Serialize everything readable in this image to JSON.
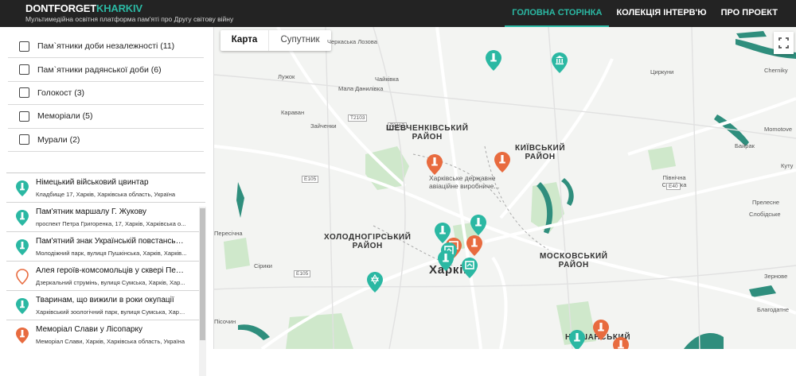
{
  "header": {
    "brand_part1": "DONTFORGET",
    "brand_part2": "KHARKIV",
    "tagline": "Мультимедійна освітня платформа пам'яті про Другу світову війну",
    "nav": [
      "ГОЛОВНА СТОРІНКА",
      "КОЛЕКЦІЯ ІНТЕРВ'Ю",
      "ПРО ПРОЕКТ"
    ],
    "active_nav": "ГОЛОВНА СТОРІНКА",
    "accent_color": "#2bb8a3"
  },
  "filters": [
    {
      "label": "Пам`ятники доби незалежності (11)",
      "checked": false
    },
    {
      "label": "Пам`ятники радянської доби (6)",
      "checked": false
    },
    {
      "label": "Голокост (3)",
      "checked": false
    },
    {
      "label": "Меморіали (5)",
      "checked": false
    },
    {
      "label": "Мурали (2)",
      "checked": false
    }
  ],
  "locations": [
    {
      "title": "Німецький військовий цвинтар",
      "address": "Кладбище 17, Харків, Харківська область, Україна",
      "pin": "teal-filled"
    },
    {
      "title": "Пам'ятник маршалу Г. Жукову",
      "address": "проспект Петра Григоренка, 17, Харків, Харківська о...",
      "pin": "teal-filled"
    },
    {
      "title": "Пам'ятний знак Українській повстанській ...",
      "address": "Молодіжний парк, вулиця Пушкінська, Харків, Харків...",
      "pin": "teal-filled"
    },
    {
      "title": "Алея героїв-комсомольців у сквері Перем...",
      "address": "Дзеркальний струмінь, вулиця Сумська, Харків, Хар...",
      "pin": "orange-outline"
    },
    {
      "title": "Тваринам, що вижили в роки окупації",
      "address": "Харківський зоологічний парк, вулиця Сумська, Харків...",
      "pin": "teal-filled"
    },
    {
      "title": "Меморіал Слави у Лісопарку",
      "address": "Меморіал Слави, Харків, Харківська область, Україна",
      "pin": "orange-filled"
    }
  ],
  "map": {
    "tabs": [
      "Карта",
      "Супутник"
    ],
    "active_tab": "Карта",
    "city": "Харків",
    "districts": [
      "ШЕВЧЕНКІВСЬКИЙ\nРАЙОН",
      "КИЇВСЬКИЙ\nРАЙОН",
      "ХОЛОДНОГІРСЬКИЙ\nРАЙОН",
      "МОСКОВСЬКИЙ\nРАЙОН",
      "Н...ШАНСЬКИЙ"
    ],
    "places": [
      "Черкаська Лозова",
      "Чайківка",
      "Мала Данилівка",
      "Лужок",
      "Караван",
      "Зайченки",
      "Пересічна",
      "Сірики",
      "Пісочин",
      "Циркуни",
      "Momotove",
      "Байрак",
      "Cherniky",
      "Пiвнічна Салтівка",
      "Прелесне",
      "Слобідське",
      "Зернове",
      "Благодатне",
      "Куту",
      "Пiлипці"
    ],
    "roads": [
      "Т2103",
      "Т2117",
      "Е105",
      "Е40",
      "Е105"
    ],
    "poi": "Харківське державне\nавіаційне виробниче...",
    "colors": {
      "teal": "#2bb8a3",
      "orange": "#e86b3f",
      "water": "#2f8e7d",
      "park": "#c9e6c6"
    }
  }
}
